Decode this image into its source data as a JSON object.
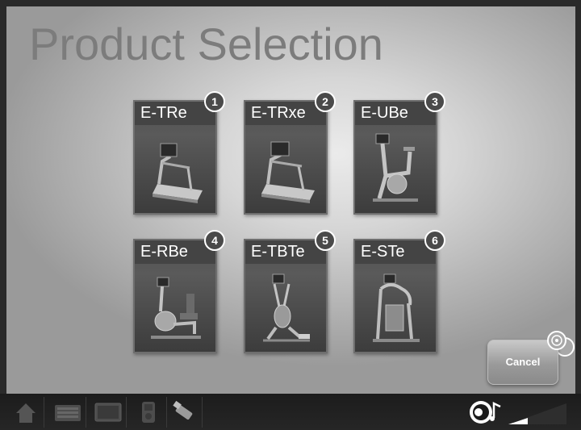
{
  "header": {
    "title": "Product Selection"
  },
  "products": [
    {
      "label": "E-TRe",
      "number": "1",
      "icon": "treadmill-icon"
    },
    {
      "label": "E-TRxe",
      "number": "2",
      "icon": "treadmill-icon"
    },
    {
      "label": "E-UBe",
      "number": "3",
      "icon": "upright-bike-icon"
    },
    {
      "label": "E-RBe",
      "number": "4",
      "icon": "recumbent-bike-icon"
    },
    {
      "label": "E-TBTe",
      "number": "5",
      "icon": "total-body-trainer-icon"
    },
    {
      "label": "E-STe",
      "number": "6",
      "icon": "stepper-icon"
    }
  ],
  "actions": {
    "cancel_label": "Cancel"
  },
  "bottom_bar": {
    "left_icons": [
      "home-icon",
      "keyboard-icon",
      "tv-icon",
      "ipod-icon",
      "usb-icon"
    ],
    "right_icons": [
      "audio-icon",
      "volume-icon"
    ]
  },
  "colors": {
    "title": "#7c7c7c",
    "tile": "#4e4e4e",
    "bar": "#1f1f1f"
  }
}
